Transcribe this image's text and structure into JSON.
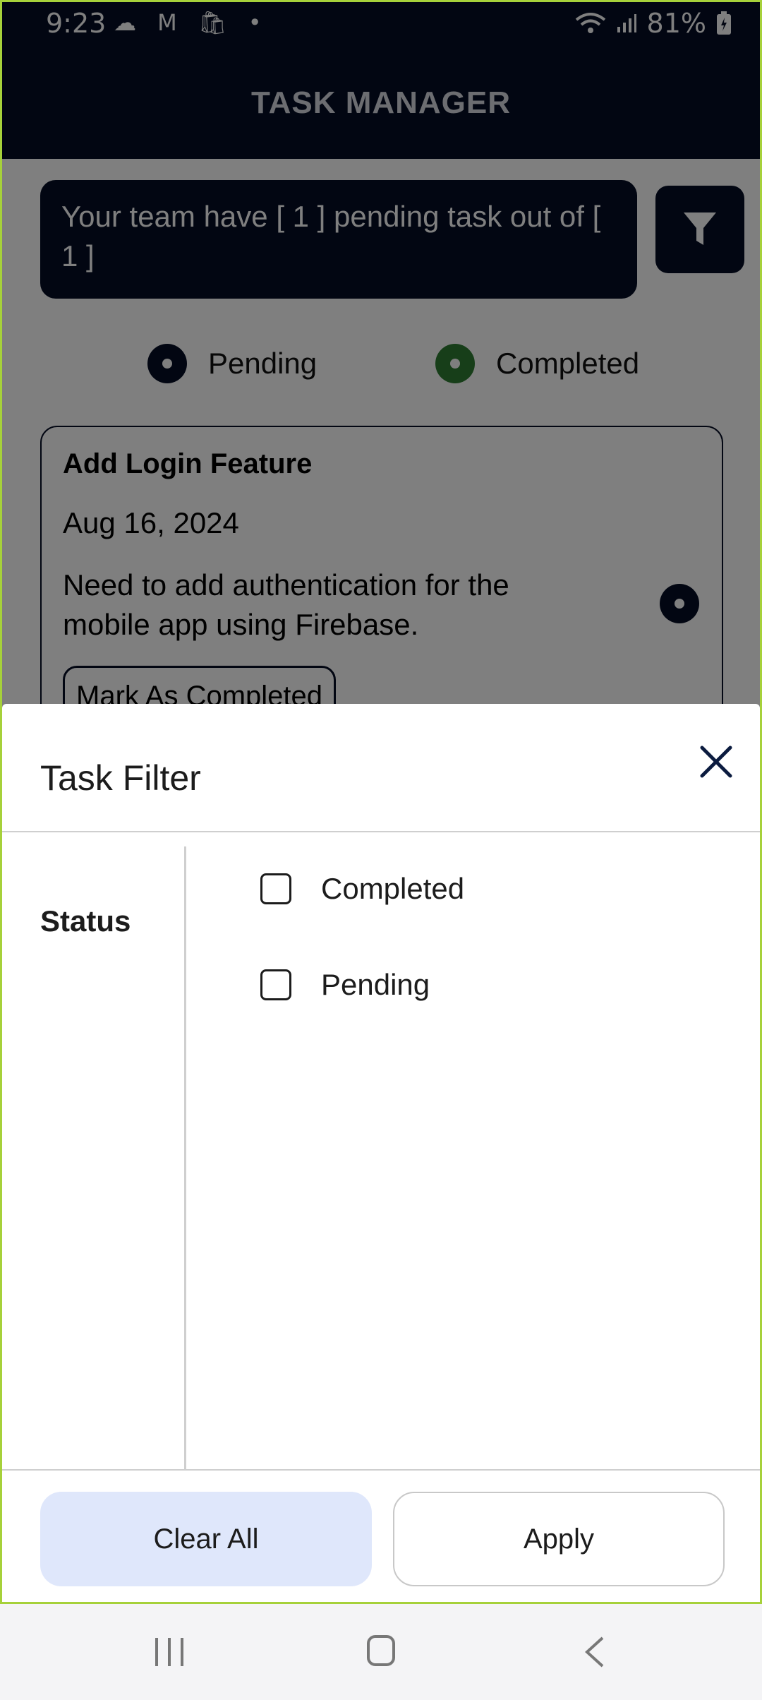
{
  "status_bar": {
    "time": "9:23",
    "left_icons": "☁ M 🛍 •",
    "battery": "81%"
  },
  "app_bar": {
    "title": "TASK MANAGER"
  },
  "banner": {
    "text": "Your team have [ 1 ] pending task out of [ 1 ]"
  },
  "legend": {
    "pending_label": "Pending",
    "completed_label": "Completed",
    "pending_color": "#050d25",
    "completed_color": "#2e7d32"
  },
  "task": {
    "title": "Add Login Feature",
    "date": "Aug 16, 2024",
    "description": "Need to add authentication for the mobile app using Firebase.",
    "action_label": "Mark As Completed"
  },
  "sheet": {
    "title": "Task Filter",
    "side_label": "Status",
    "options": [
      {
        "label": "Completed",
        "checked": false
      },
      {
        "label": "Pending",
        "checked": false
      }
    ],
    "clear_label": "Clear All",
    "apply_label": "Apply"
  },
  "colors": {
    "primary": "#050d25",
    "accent_border": "#a6d13a",
    "clear_bg": "#dfe7fb"
  }
}
